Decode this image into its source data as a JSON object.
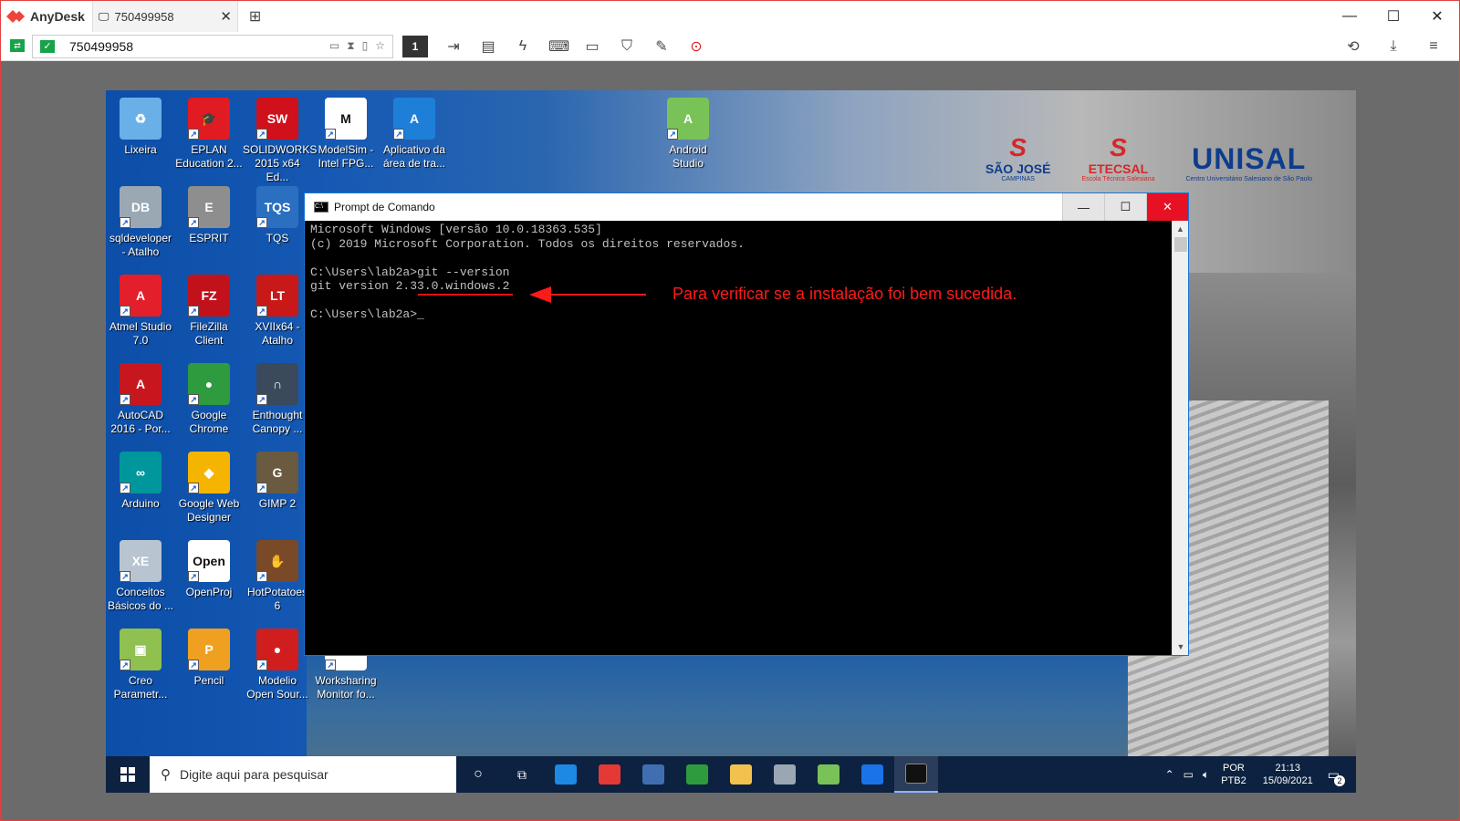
{
  "anydesk": {
    "app_name": "AnyDesk",
    "tab_label": "750499958",
    "address_value": "750499958",
    "monitor_number": "1",
    "new_tab_glyph": "⊞",
    "close_glyph": "✕"
  },
  "desktop": {
    "icons": [
      {
        "label": "Lixeira",
        "color": "#6ab0e8",
        "glyph": "♻"
      },
      {
        "label": "EPLAN\nEducation 2...",
        "color": "#e01b22",
        "glyph": "🎓"
      },
      {
        "label": "SOLIDWORKS\n2015 x64 Ed...",
        "color": "#d0101a",
        "glyph": "SW"
      },
      {
        "label": "ModelSim -\nIntel FPG...",
        "color": "#ffffff",
        "glyph": "M"
      },
      {
        "label": "Aplicativo da\nárea de tra...",
        "color": "#1e7fd8",
        "glyph": "A"
      },
      {
        "label": "Android\nStudio",
        "color": "#78c257",
        "glyph": "A"
      },
      {
        "label": "sqldeveloper\n- Atalho",
        "color": "#9aa8b4",
        "glyph": "DB"
      },
      {
        "label": "ESPRIT",
        "color": "#8e8e8e",
        "glyph": "E"
      },
      {
        "label": "TQS",
        "color": "#2a6fc0",
        "glyph": "TQS"
      },
      {
        "label": "Atmel Studio\n7.0",
        "color": "#e21f2a",
        "glyph": "A"
      },
      {
        "label": "FileZilla\nClient",
        "color": "#c1121c",
        "glyph": "FZ"
      },
      {
        "label": "XVIIx64 -\nAtalho",
        "color": "#c81818",
        "glyph": "LT"
      },
      {
        "label": "AutoCAD\n2016 - Por...",
        "color": "#c8161e",
        "glyph": "A"
      },
      {
        "label": "Google\nChrome",
        "color": "#2e9b3e",
        "glyph": "●"
      },
      {
        "label": "Enthought\nCanopy ...",
        "color": "#3a4a5c",
        "glyph": "∩"
      },
      {
        "label": "Arduino",
        "color": "#00979c",
        "glyph": "∞"
      },
      {
        "label": "Google Web\nDesigner",
        "color": "#f4b400",
        "glyph": "◆"
      },
      {
        "label": "GIMP 2",
        "color": "#6a5a40",
        "glyph": "G"
      },
      {
        "label": "Conceitos\nBásicos do ...",
        "color": "#b8c4d0",
        "glyph": "XE"
      },
      {
        "label": "OpenProj",
        "color": "#ffffff",
        "glyph": "Open"
      },
      {
        "label": "HotPotatoes\n6",
        "color": "#7a4a28",
        "glyph": "✋"
      },
      {
        "label": "Creo\nParametr...",
        "color": "#8fc050",
        "glyph": "▣"
      },
      {
        "label": "Pencil",
        "color": "#f0a020",
        "glyph": "P"
      },
      {
        "label": "Modelio\nOpen Sour...",
        "color": "#d01e1e",
        "glyph": "●"
      },
      {
        "label": "Worksharing\nMonitor fo...",
        "color": "#ffffff",
        "glyph": "WM"
      }
    ],
    "logos": {
      "sj_name": "SÃO JOSÉ",
      "sj_sub": "CAMPINAS",
      "etec_name": "ETECSAL",
      "etec_sub": "Escola Técnica Salesiana",
      "unisal_name": "UNISAL",
      "unisal_sub": "Centro Universitário Salesiano de São Paulo"
    }
  },
  "cmd": {
    "title": "Prompt de Comando",
    "lines": [
      "Microsoft Windows [versão 10.0.18363.535]",
      "(c) 2019 Microsoft Corporation. Todos os direitos reservados.",
      "",
      "C:\\Users\\lab2a>git --version",
      "git version 2.33.0.windows.2",
      "",
      "C:\\Users\\lab2a>_"
    ],
    "annotation": "Para verificar se a instalação foi bem sucedida.",
    "annotation_color": "#ff1a1a"
  },
  "taskbar": {
    "search_placeholder": "Digite aqui para pesquisar",
    "lang_top": "POR",
    "lang_bottom": "PTB2",
    "time": "21:13",
    "date": "15/09/2021",
    "notif_count": "2",
    "apps": [
      {
        "name": "mail",
        "color": "#1e88e5"
      },
      {
        "name": "anydesk",
        "color": "#e53935"
      },
      {
        "name": "virtualbox",
        "color": "#3f6fb0"
      },
      {
        "name": "chrome",
        "color": "#2e9b3e"
      },
      {
        "name": "explorer",
        "color": "#f2c14e"
      },
      {
        "name": "photos",
        "color": "#9aa6b2"
      },
      {
        "name": "android-studio",
        "color": "#78c257"
      },
      {
        "name": "edge",
        "color": "#1a73e8"
      },
      {
        "name": "cmd",
        "color": "#111111"
      }
    ]
  }
}
